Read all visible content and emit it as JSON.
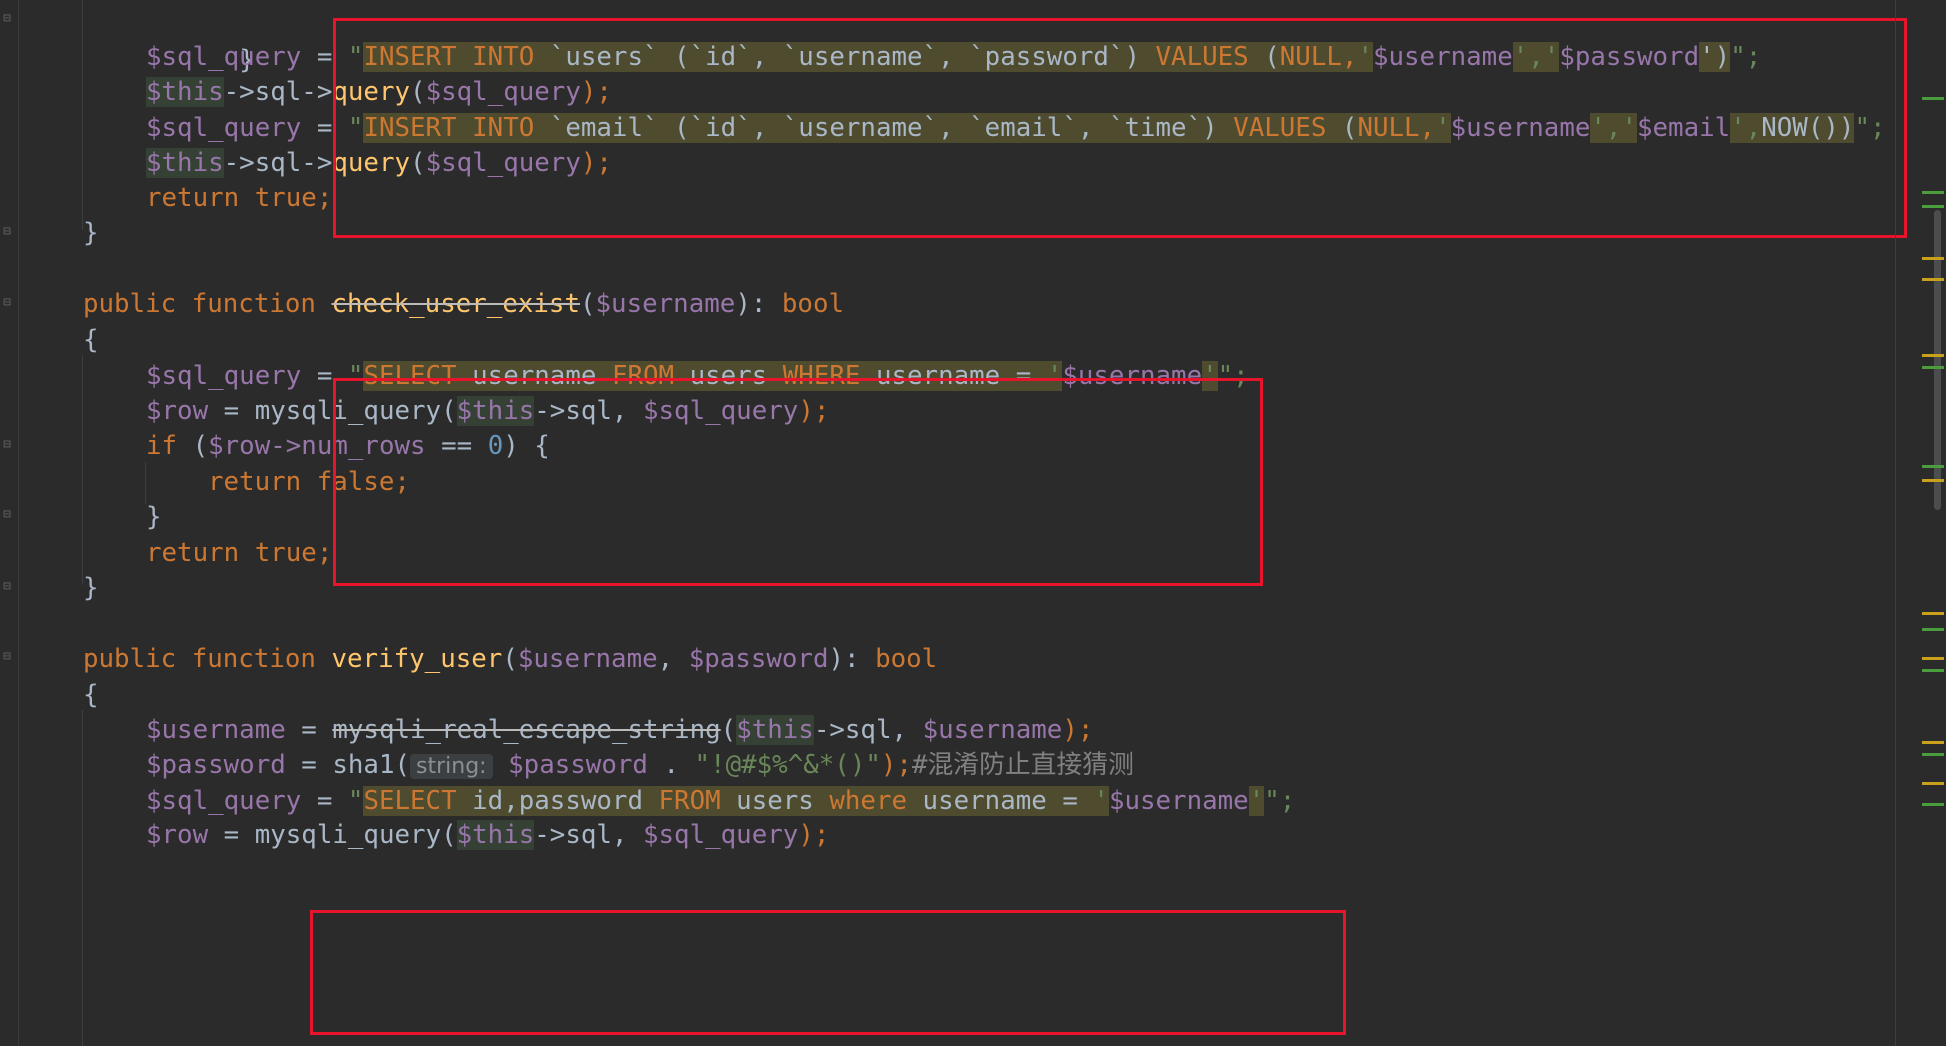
{
  "colors": {
    "background": "#2b2b2b",
    "keyword": "#cc7832",
    "variable": "#9876aa",
    "function": "#ffc66d",
    "plain": "#a9b7c6",
    "number": "#6897bb",
    "string": "#6a8759",
    "sql_highlight": "#4e4b2f",
    "annotation_box": "#e8142c"
  },
  "code": {
    "l1": {
      "brace": "}"
    },
    "l2": {
      "var": "$sql_query",
      "eq": " = ",
      "q1": "\"",
      "insert_into": "INSERT INTO",
      "table": " `users` (`id`, `username`, `password`) ",
      "values": "VALUES",
      "p1": " (",
      "null": "NULL,",
      "tick1": "'",
      "u": "$username",
      "sep": "','",
      "pw": "$password",
      "close": "')",
      "q2": "\";"
    },
    "l3": {
      "this": "$this",
      "arrow": "->sql->",
      "fn": "query",
      "args_open": "(",
      "arg": "$sql_query",
      "end": ");"
    },
    "l4": {
      "var": "$sql_query",
      "eq": " = ",
      "q1": "\"",
      "insert_into": "INSERT INTO",
      "table": " `email` (`id`, `username`, `email`, `time`) ",
      "values": "VALUES",
      "p1": " (",
      "null": "NULL,",
      "tick1": "'",
      "u": "$username",
      "sep": "','",
      "em": "$email",
      "sep2": "',",
      "now": "NOW())",
      "q2": "\";"
    },
    "l5": {
      "this": "$this",
      "arrow": "->sql->",
      "fn": "query",
      "args_open": "(",
      "arg": "$sql_query",
      "end": ");"
    },
    "l6": {
      "ret": "return",
      "val": " true;"
    },
    "l7": {
      "brace": "}"
    },
    "l8": {
      "kw": "public function ",
      "fn": "check_user_exist",
      "po": "(",
      "param": "$username",
      "pc": "): ",
      "type": "bool"
    },
    "l9": {
      "brace": "{"
    },
    "l10": {
      "var": "$sql_query",
      "eq": " = ",
      "q1": "\"",
      "select": "SELECT",
      "col": " username ",
      "from": "FROM",
      "tbl": " users ",
      "where": "WHERE",
      "cond": " username = ",
      "tick": "'",
      "u": "$username",
      "tick2": "'",
      "q2": "\";"
    },
    "l11": {
      "var": "$row",
      "eq": " = ",
      "fn": "mysqli_query",
      "po": "(",
      "this": "$this",
      "rest": "->sql, ",
      "arg": "$sql_query",
      "end": ");"
    },
    "l12": {
      "kw": "if",
      "po": " (",
      "var": "$row",
      "prop": "->num_rows",
      "op": " == ",
      "num": "0",
      "end": ") {"
    },
    "l13": {
      "ret": "return",
      "val": " false;"
    },
    "l14": {
      "brace": "}"
    },
    "l15": {
      "ret": "return",
      "val": " true;"
    },
    "l16": {
      "brace": "}"
    },
    "l17": {
      "kw": "public function ",
      "fn": "verify_user",
      "po": "(",
      "p1": "$username",
      "comma": ", ",
      "p2": "$password",
      "pc": "): ",
      "type": "bool"
    },
    "l18": {
      "brace": "{"
    },
    "l19": {
      "var": "$username",
      "eq": " = ",
      "fn": "mysqli_real_escape_string",
      "po": "(",
      "this": "$this",
      "rest": "->sql, ",
      "arg": "$username",
      "end": ");"
    },
    "l20": {
      "var": "$password",
      "eq": " = ",
      "fn": "sha1",
      "po": "(",
      "hint": "string:",
      "arg": " $password",
      "dot": " . ",
      "str": "\"!@#$%^&*()\"",
      "end": ");",
      "comment_hash": "#",
      "comment": "混淆防止直接猜测"
    },
    "l21": {
      "var": "$sql_query",
      "eq": " = ",
      "q1": "\"",
      "select": "SELECT",
      "col": " id,password ",
      "from": "FROM",
      "tbl": " users ",
      "where": "where",
      "cond": " username = ",
      "tick": "'",
      "u": "$username",
      "tick2": "'",
      "q2": "\";"
    },
    "l22": {
      "var": "$row",
      "eq": " = ",
      "fn": "mysqli_query",
      "po": "(",
      "this": "$this",
      "rest": "->sql, ",
      "arg": "$sql_query",
      "end": ");"
    }
  },
  "scrollbar_markers": [
    {
      "color": "#4a9c3c",
      "pos": 0.093
    },
    {
      "color": "#4a9c3c",
      "pos": 0.183
    },
    {
      "color": "#4a9c3c",
      "pos": 0.196
    },
    {
      "color": "#c7a11a",
      "pos": 0.246
    },
    {
      "color": "#c7a11a",
      "pos": 0.266
    },
    {
      "color": "#c7a11a",
      "pos": 0.338
    },
    {
      "color": "#4a9c3c",
      "pos": 0.35
    },
    {
      "color": "#4a9c3c",
      "pos": 0.445
    },
    {
      "color": "#c7a11a",
      "pos": 0.458
    },
    {
      "color": "#c7a11a",
      "pos": 0.585
    },
    {
      "color": "#4a9c3c",
      "pos": 0.6
    },
    {
      "color": "#c7a11a",
      "pos": 0.628
    },
    {
      "color": "#4a9c3c",
      "pos": 0.64
    },
    {
      "color": "#c7a11a",
      "pos": 0.708
    },
    {
      "color": "#4a9c3c",
      "pos": 0.72
    },
    {
      "color": "#c7a11a",
      "pos": 0.748
    },
    {
      "color": "#4a9c3c",
      "pos": 0.768
    }
  ]
}
